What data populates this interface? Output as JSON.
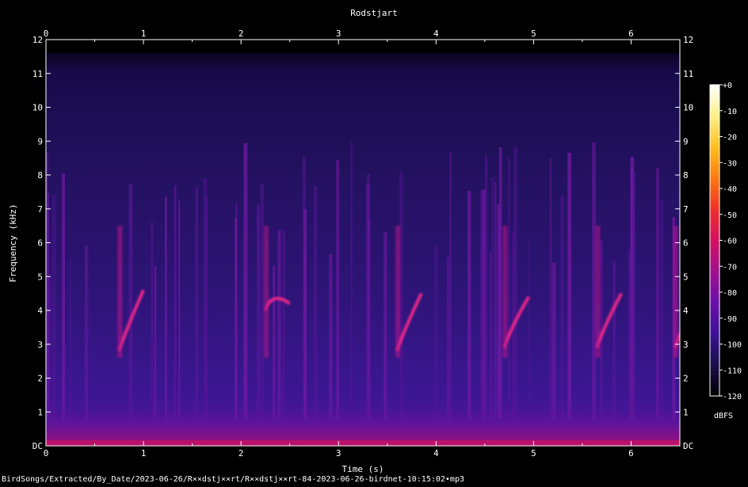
{
  "chart_data": {
    "type": "heatmap",
    "title": "Rodstjart",
    "xlabel": "Time (s)",
    "ylabel": "Frequency (kHz)",
    "xlim": [
      0,
      6.5
    ],
    "ylim": [
      0,
      12
    ],
    "x_ticks": [
      "0",
      "1",
      "2",
      "3",
      "4",
      "5",
      "6"
    ],
    "y_ticks": [
      "DC",
      "1",
      "2",
      "3",
      "4",
      "5",
      "6",
      "7",
      "8",
      "9",
      "10",
      "11",
      "12"
    ],
    "colorbar": {
      "label": "dBFS",
      "ticks": [
        "+0",
        "-10",
        "-20",
        "-30",
        "-40",
        "-50",
        "-60",
        "-70",
        "-80",
        "-90",
        "-100",
        "-110",
        "-120"
      ],
      "range": [
        -120,
        0
      ],
      "colors": [
        "#000000",
        "#1a0e4a",
        "#3c1296",
        "#6a10a8",
        "#a0108f",
        "#d31060",
        "#f0302a",
        "#fb7a10",
        "#ffc020",
        "#fff08a",
        "#ffffff"
      ]
    },
    "calls": [
      {
        "t": 0.75,
        "f_start": 2.8,
        "f_end": 4.6
      },
      {
        "t": 2.25,
        "f_start": 4.0,
        "f_end": 4.2
      },
      {
        "t": 3.6,
        "f_start": 2.8,
        "f_end": 4.5
      },
      {
        "t": 4.7,
        "f_start": 2.9,
        "f_end": 4.4
      },
      {
        "t": 5.65,
        "f_start": 2.9,
        "f_end": 4.5
      },
      {
        "t": 6.45,
        "f_start": 2.9,
        "f_end": 4.1
      }
    ]
  },
  "footer": {
    "filename": "BirdSongs/Extracted/By_Date/2023-06-26/R××dstj××rt/R××dstj××rt-84-2023-06-26-birdnet-10:15:02•mp3"
  }
}
